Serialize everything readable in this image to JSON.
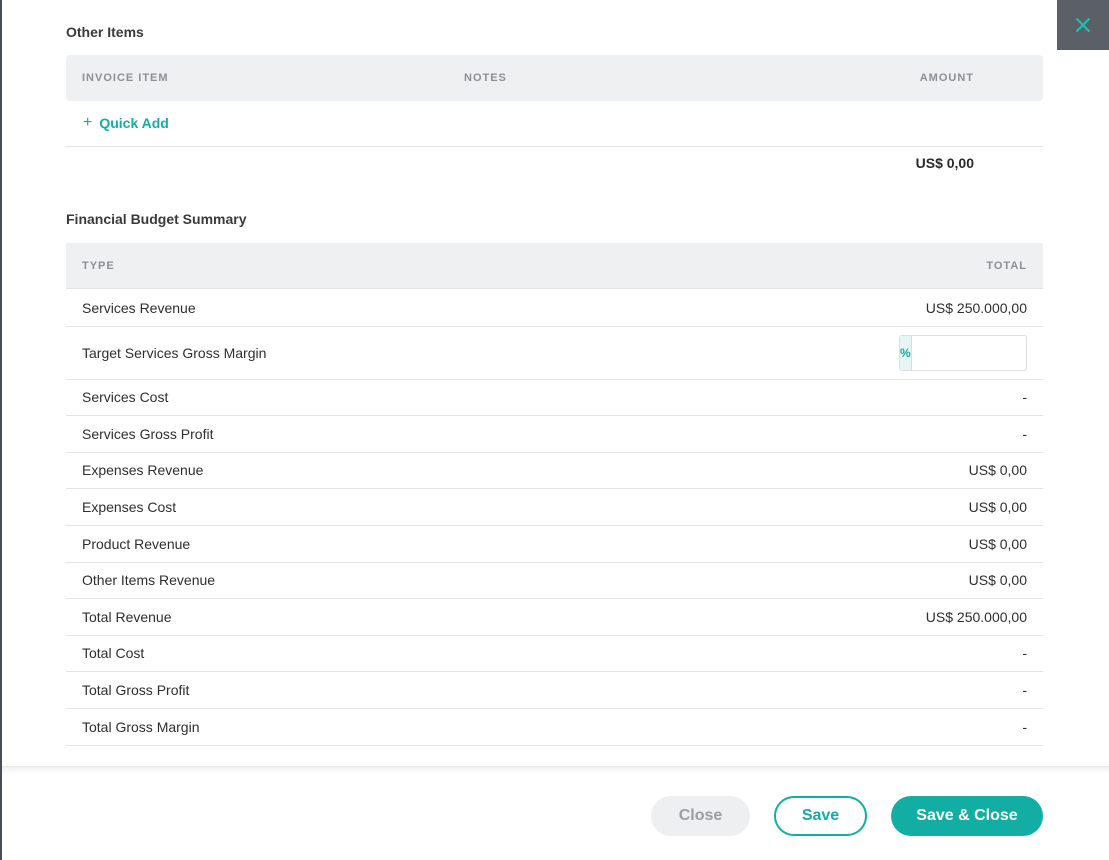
{
  "other_items": {
    "title": "Other Items",
    "columns": {
      "item": "INVOICE ITEM",
      "notes": "NOTES",
      "amount": "AMOUNT"
    },
    "quick_add": {
      "icon": "+",
      "label": "Quick Add"
    },
    "total": "US$ 0,00"
  },
  "budget": {
    "title": "Financial Budget Summary",
    "columns": {
      "type": "TYPE",
      "total": "TOTAL"
    },
    "rows": [
      {
        "label": "Services Revenue",
        "value": "US$ 250.000,00"
      },
      {
        "label": "Target Services Gross Margin",
        "addon": "%",
        "input_value": ""
      },
      {
        "label": "Services Cost",
        "value": "-"
      },
      {
        "label": "Services Gross Profit",
        "value": "-"
      },
      {
        "label": "Expenses Revenue",
        "value": "US$ 0,00"
      },
      {
        "label": "Expenses Cost",
        "value": "US$ 0,00"
      },
      {
        "label": "Product Revenue",
        "value": "US$ 0,00"
      },
      {
        "label": "Other Items Revenue",
        "value": "US$ 0,00"
      },
      {
        "label": "Total Revenue",
        "value": "US$ 250.000,00"
      },
      {
        "label": "Total Cost",
        "value": "-"
      },
      {
        "label": "Total Gross Profit",
        "value": "-"
      },
      {
        "label": "Total Gross Margin",
        "value": "-"
      }
    ]
  },
  "footer": {
    "close_label": "Close",
    "save_label": "Save",
    "save_close_label": "Save & Close"
  },
  "icons": {
    "close": "close-icon",
    "plus": "plus-icon"
  },
  "colors": {
    "accent": "#13aea3",
    "header_bg": "#eff0f2",
    "close_tab_bg": "#5b6067"
  }
}
